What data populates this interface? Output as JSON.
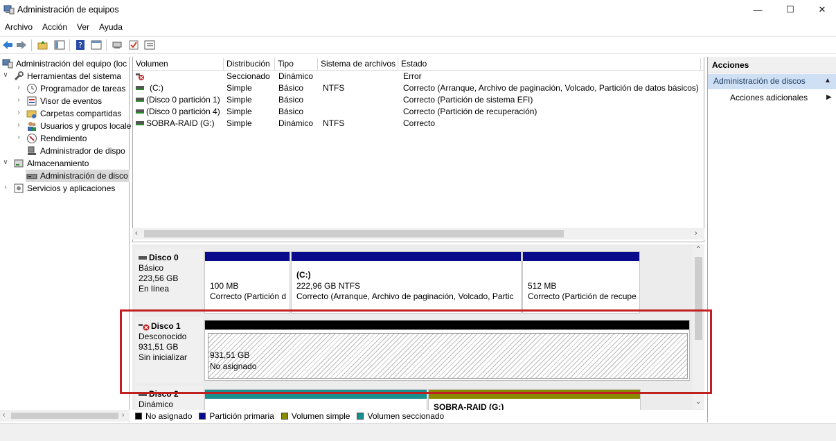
{
  "window": {
    "title": "Administración de equipos",
    "minimize": "—",
    "maximize": "☐",
    "close": "✕"
  },
  "menu": [
    "Archivo",
    "Acción",
    "Ver",
    "Ayuda"
  ],
  "tree": {
    "root": "Administración del equipo (loc",
    "system_tools": "Herramientas del sistema",
    "task_scheduler": "Programador de tareas",
    "event_viewer": "Visor de eventos",
    "shared_folders": "Carpetas compartidas",
    "users_groups": "Usuarios y grupos locale",
    "performance": "Rendimiento",
    "device_manager": "Administrador de dispo",
    "storage": "Almacenamiento",
    "disk_management": "Administración de disco",
    "services_apps": "Servicios y aplicaciones"
  },
  "volumes": {
    "columns": [
      "Volumen",
      "Distribución",
      "Tipo",
      "Sistema de archivos",
      "Estado"
    ],
    "rows": [
      {
        "volume": "",
        "layout": "Seccionado",
        "type": "Dinámico",
        "fs": "",
        "status": "Error"
      },
      {
        "volume": "(C:)",
        "layout": "Simple",
        "type": "Básico",
        "fs": "NTFS",
        "status": "Correcto (Arranque, Archivo de paginación, Volcado, Partición de datos básicos)"
      },
      {
        "volume": "(Disco 0 partición 1)",
        "layout": "Simple",
        "type": "Básico",
        "fs": "",
        "status": "Correcto (Partición de sistema EFI)"
      },
      {
        "volume": "(Disco 0 partición 4)",
        "layout": "Simple",
        "type": "Básico",
        "fs": "",
        "status": "Correcto (Partición de recuperación)"
      },
      {
        "volume": "SOBRA-RAID (G:)",
        "layout": "Simple",
        "type": "Dinámico",
        "fs": "NTFS",
        "status": "Correcto"
      }
    ]
  },
  "disks": {
    "disk0": {
      "name": "Disco 0",
      "type": "Básico",
      "size": "223,56 GB",
      "state": "En línea",
      "p1_size": "100 MB",
      "p1_status": "Correcto (Partición d",
      "p2_name": "(C:)",
      "p2_size": "222,96 GB NTFS",
      "p2_status": "Correcto (Arranque, Archivo de paginación, Volcado, Partic",
      "p3_size": "512 MB",
      "p3_status": "Correcto (Partición de recupe"
    },
    "disk1": {
      "name": "Disco 1",
      "type": "Desconocido",
      "size": "931,51 GB",
      "state": "Sin inicializar",
      "p1_size": "931,51 GB",
      "p1_status": "No asignado"
    },
    "disk2": {
      "name": "Disco 2",
      "type": "Dinámico",
      "p2_name": "SOBRA-RAID  (G:)"
    }
  },
  "legend": [
    {
      "label": "No asignado",
      "color": "#000000"
    },
    {
      "label": "Partición primaria",
      "color": "#0a0a8c"
    },
    {
      "label": "Volumen simple",
      "color": "#8a8a00"
    },
    {
      "label": "Volumen seccionado",
      "color": "#1a8f8f"
    }
  ],
  "actions": {
    "title": "Acciones",
    "section": "Administración de discos",
    "more": "Acciones adicionales"
  },
  "colors": {
    "primary_partition": "#0a0a8c",
    "unallocated": "#000000",
    "simple_volume": "#8a8a00",
    "striped_volume": "#1a8f8f",
    "highlight": "#c02020",
    "selection": "#cfe0f4"
  }
}
